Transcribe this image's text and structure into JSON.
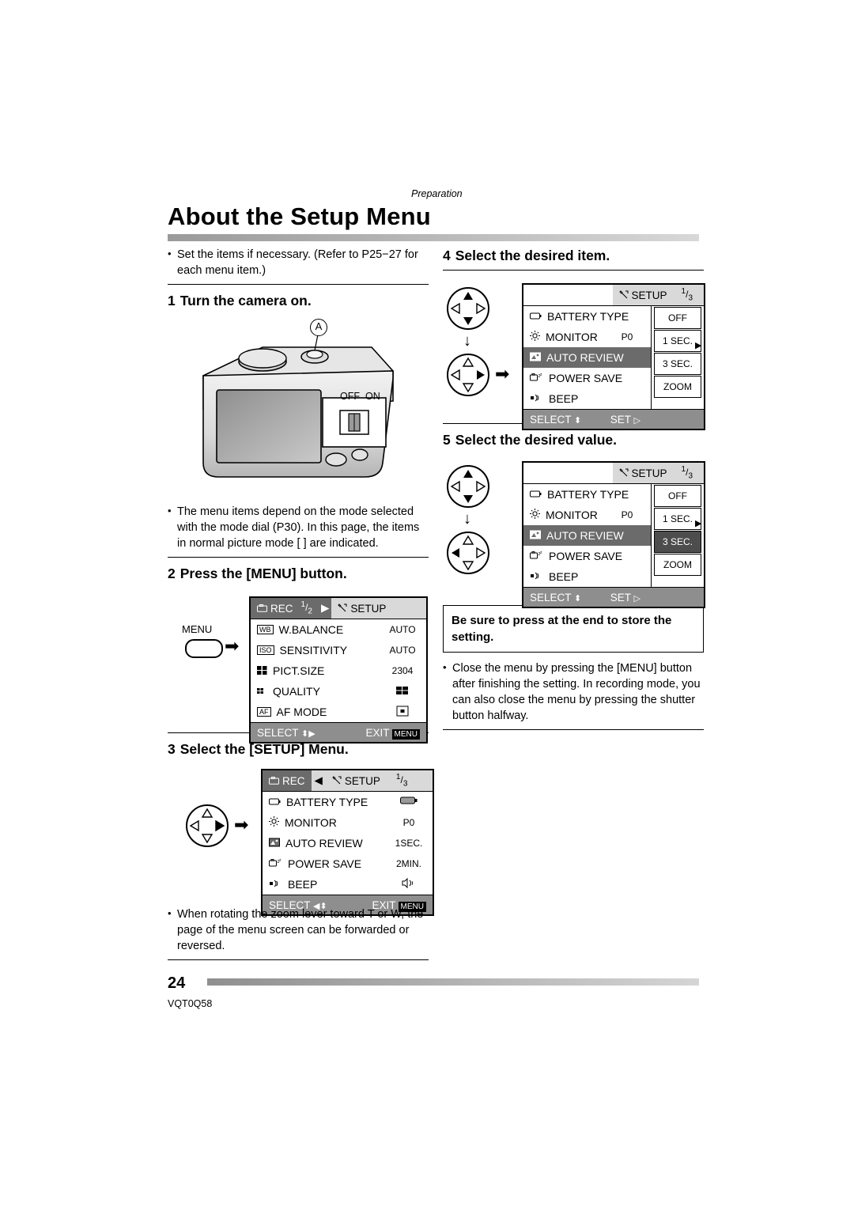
{
  "running_head": "Preparation",
  "title": "About the Setup Menu",
  "page_number": "24",
  "doc_code": "VQT0Q58",
  "left": {
    "intro_bullet": "Set the items if necessary. (Refer to P25−27 for each menu item.)",
    "step1": {
      "num": "1",
      "text": "Turn the camera on."
    },
    "camera": {
      "callout_a": "A",
      "switch_off": "OFF",
      "switch_on": "ON"
    },
    "bullet_mode": "The menu items depend on the mode selected with the mode dial (P30). In this page, the items in normal picture mode [      ] are indicated.",
    "step2": {
      "num": "2",
      "text": "Press the [MENU] button."
    },
    "menu_button_label": "MENU",
    "rec_menu": {
      "tab_rec": "REC",
      "tab_rec_page": "1/2",
      "tab_setup": "SETUP",
      "rows": [
        {
          "icon": "WB",
          "label": "W.BALANCE",
          "value": "AUTO"
        },
        {
          "icon": "ISO",
          "label": "SENSITIVITY",
          "value": "AUTO"
        },
        {
          "icon": "pictsize-icon",
          "label": "PICT.SIZE",
          "value": "2304"
        },
        {
          "icon": "quality-icon",
          "label": "QUALITY",
          "value": ""
        },
        {
          "icon": "AF",
          "label": "AF MODE",
          "value": ""
        }
      ],
      "footer_select": "SELECT",
      "footer_exit": "EXIT",
      "footer_menu_tag": "MENU"
    },
    "step3": {
      "num": "3",
      "text": "Select the [SETUP] Menu."
    },
    "setup_menu": {
      "tab_rec": "REC",
      "tab_setup": "SETUP",
      "page": "1/3",
      "rows": [
        {
          "label": "BATTERY TYPE",
          "value": ""
        },
        {
          "label": "MONITOR",
          "value": "P0"
        },
        {
          "label": "AUTO REVIEW",
          "value": "1SEC."
        },
        {
          "label": "POWER SAVE",
          "value": "2MIN."
        },
        {
          "label": "BEEP",
          "value": ""
        }
      ],
      "footer_select": "SELECT",
      "footer_exit": "EXIT",
      "footer_menu_tag": "MENU"
    },
    "bullet_zoom": "When rotating the zoom lever      toward T or W, the page of the menu screen can be forwarded or reversed."
  },
  "right": {
    "step4": {
      "num": "4",
      "text": "Select the desired item."
    },
    "menu4": {
      "tab_setup": "SETUP",
      "page": "1/3",
      "rows": [
        {
          "label": "BATTERY TYPE",
          "value": "",
          "selected": false
        },
        {
          "label": "MONITOR",
          "value": "P0",
          "selected": false
        },
        {
          "label": "AUTO REVIEW",
          "value": "",
          "selected": true
        },
        {
          "label": "POWER SAVE",
          "value": "",
          "selected": false
        },
        {
          "label": "BEEP",
          "value": "",
          "selected": false
        }
      ],
      "values": [
        {
          "text": "OFF",
          "selected": false
        },
        {
          "text": "1 SEC.",
          "selected": false
        },
        {
          "text": "3 SEC.",
          "selected": false
        },
        {
          "text": "ZOOM",
          "selected": false
        }
      ],
      "footer_select": "SELECT",
      "footer_set": "SET"
    },
    "step5": {
      "num": "5",
      "text": "Select the desired value."
    },
    "menu5": {
      "tab_setup": "SETUP",
      "page": "1/3",
      "rows": [
        {
          "label": "BATTERY TYPE",
          "value": "",
          "selected": false
        },
        {
          "label": "MONITOR",
          "value": "P0",
          "selected": false
        },
        {
          "label": "AUTO REVIEW",
          "value": "",
          "selected": true
        },
        {
          "label": "POWER SAVE",
          "value": "",
          "selected": false
        },
        {
          "label": "BEEP",
          "value": "",
          "selected": false
        }
      ],
      "values": [
        {
          "text": "OFF",
          "selected": false
        },
        {
          "text": "1 SEC.",
          "selected": false
        },
        {
          "text": "3 SEC.",
          "selected": true
        },
        {
          "text": "ZOOM",
          "selected": false
        }
      ],
      "footer_select": "SELECT",
      "footer_set": "SET"
    },
    "note": "Be sure to press      at the end to store the setting.",
    "bullet_close": "Close the menu by pressing the [MENU] button after finishing the setting. In recording mode, you can also close the menu by pressing the shutter button halfway."
  }
}
